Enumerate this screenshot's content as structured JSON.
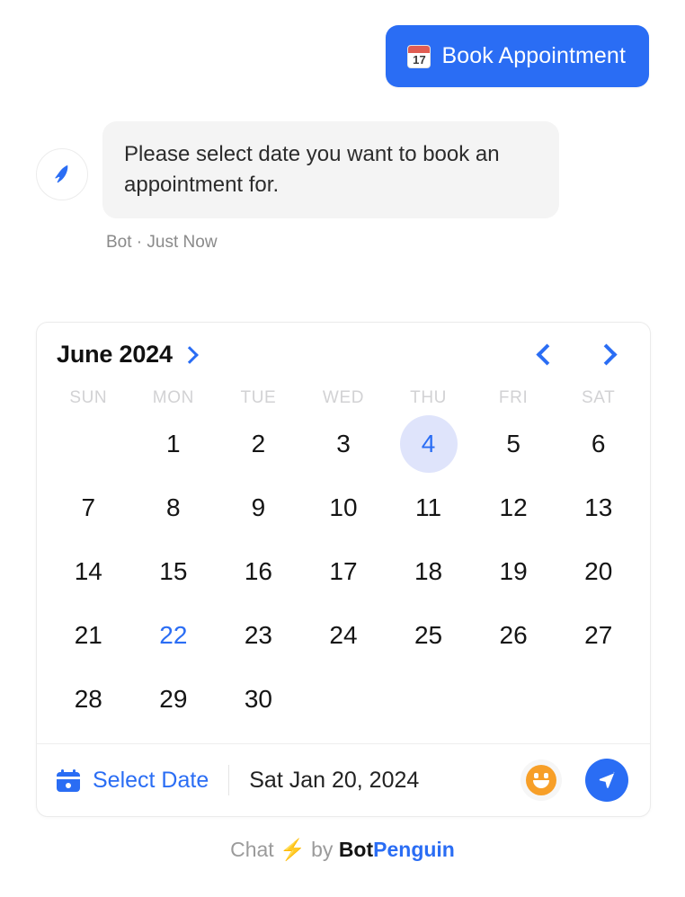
{
  "quick_reply": {
    "label": "Book Appointment",
    "icon": "calendar-emoji",
    "emoji_day": "17",
    "bg_color": "#2a6df4"
  },
  "message": {
    "avatar_icon": "botpenguin-logo",
    "text": "Please select date you want to book an appointment for.",
    "meta": "Bot · Just Now",
    "sender": "Bot",
    "timestamp": "Just Now"
  },
  "calendar": {
    "title": "June 2024",
    "title_chevron_icon": "chevron-right-icon",
    "prev_icon": "chevron-left-icon",
    "next_icon": "chevron-right-icon",
    "weekdays": [
      "SUN",
      "MON",
      "TUE",
      "WED",
      "THU",
      "FRI",
      "SAT"
    ],
    "leading_blanks": 1,
    "days": [
      {
        "d": "1",
        "state": "normal"
      },
      {
        "d": "2",
        "state": "normal"
      },
      {
        "d": "3",
        "state": "normal"
      },
      {
        "d": "4",
        "state": "selected"
      },
      {
        "d": "5",
        "state": "normal"
      },
      {
        "d": "6",
        "state": "normal"
      },
      {
        "d": "7",
        "state": "normal"
      },
      {
        "d": "8",
        "state": "normal"
      },
      {
        "d": "9",
        "state": "normal"
      },
      {
        "d": "10",
        "state": "normal"
      },
      {
        "d": "11",
        "state": "normal"
      },
      {
        "d": "12",
        "state": "normal"
      },
      {
        "d": "13",
        "state": "normal"
      },
      {
        "d": "14",
        "state": "normal"
      },
      {
        "d": "15",
        "state": "normal"
      },
      {
        "d": "16",
        "state": "normal"
      },
      {
        "d": "17",
        "state": "normal"
      },
      {
        "d": "18",
        "state": "normal"
      },
      {
        "d": "19",
        "state": "normal"
      },
      {
        "d": "20",
        "state": "normal"
      },
      {
        "d": "21",
        "state": "normal"
      },
      {
        "d": "22",
        "state": "today"
      },
      {
        "d": "23",
        "state": "normal"
      },
      {
        "d": "24",
        "state": "normal"
      },
      {
        "d": "25",
        "state": "normal"
      },
      {
        "d": "26",
        "state": "normal"
      },
      {
        "d": "27",
        "state": "normal"
      },
      {
        "d": "28",
        "state": "normal"
      },
      {
        "d": "29",
        "state": "normal"
      },
      {
        "d": "30",
        "state": "normal"
      }
    ],
    "selected_day": "4",
    "today_day": "22",
    "accent_color": "#2a6df4",
    "selected_bg_color": "#dfe4fb"
  },
  "footer_bar": {
    "calendar_icon": "calendar-icon",
    "select_date_label": "Select Date",
    "date_value": "Sat Jan 20, 2024",
    "emoji_icon": "smiley-icon",
    "send_icon": "send-icon"
  },
  "branding": {
    "chat_text": "Chat",
    "bolt": "⚡",
    "by_text": "by",
    "brand_first": "Bot",
    "brand_second": "Penguin"
  }
}
